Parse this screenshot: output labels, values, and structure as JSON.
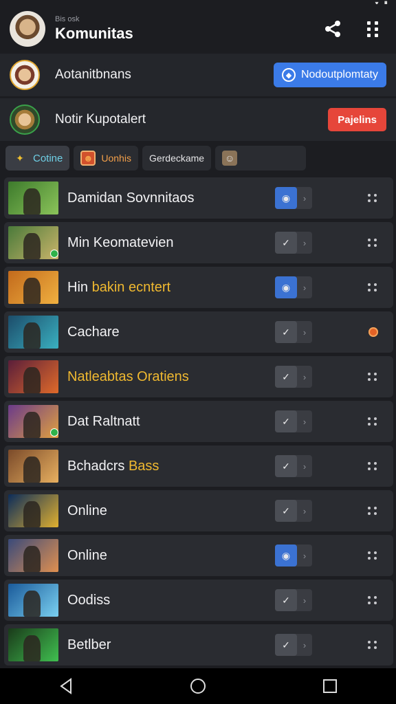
{
  "header": {
    "subtitle": "Bis osk",
    "title": "Komunitas"
  },
  "notifications": [
    {
      "text": "Aotanitbnans",
      "action": "Nodoutplomtaty",
      "action_color": "#3b7be8"
    },
    {
      "text": "Notir Kupotalert",
      "action": "Pajelins",
      "action_color": "#e6463a"
    }
  ],
  "chips": [
    {
      "label": "Cotine",
      "icon": "trophy-icon"
    },
    {
      "label": "Uonhis",
      "icon": "character-icon"
    },
    {
      "label": "Gerdeckame",
      "icon": ""
    },
    {
      "label": "",
      "icon": "portrait-icon"
    }
  ],
  "games": [
    {
      "title": "Damidan Sovnnitaos",
      "toggle": "on",
      "thumb": [
        "#3d7a2c",
        "#8bc45a"
      ],
      "badge": false,
      "marker": "menu"
    },
    {
      "title": "Min Keomatevien",
      "toggle": "off",
      "thumb": [
        "#4a7a3a",
        "#c9b46a"
      ],
      "badge": true,
      "marker": "menu"
    },
    {
      "title": "Hin",
      "title_highlight": "bakin ecntert",
      "toggle": "on",
      "thumb": [
        "#c26a1c",
        "#f0b040"
      ],
      "badge": false,
      "marker": "menu"
    },
    {
      "title": "Cachare",
      "toggle": "off",
      "thumb": [
        "#1c4c6a",
        "#3ab0c0"
      ],
      "badge": false,
      "marker": "alert"
    },
    {
      "title": "Natleabtas Oratiens",
      "toggle": "off",
      "thumb": [
        "#5a1e3a",
        "#e06a2a"
      ],
      "badge": false,
      "marker": "menu",
      "gold": true
    },
    {
      "title": "Dat Raltnatt",
      "toggle": "off",
      "thumb": [
        "#6a3a8a",
        "#e0a040"
      ],
      "badge": true,
      "marker": "menu"
    },
    {
      "title": "Bchadcrs",
      "title_highlight": "Bass",
      "toggle": "off",
      "thumb": [
        "#7a4a2a",
        "#e8b060"
      ],
      "badge": false,
      "marker": "menu"
    },
    {
      "title": "Online",
      "toggle": "off",
      "thumb": [
        "#0c2c5a",
        "#e0b030"
      ],
      "badge": false,
      "marker": "menu"
    },
    {
      "title": "Online",
      "toggle": "on",
      "thumb": [
        "#3a4a7a",
        "#e09050"
      ],
      "badge": false,
      "marker": "menu"
    },
    {
      "title": "Oodiss",
      "toggle": "off",
      "thumb": [
        "#1a5a9a",
        "#7ad0f0"
      ],
      "badge": false,
      "marker": "menu"
    },
    {
      "title": "Betlber",
      "toggle": "off",
      "thumb": [
        "#1a3a1a",
        "#40c050"
      ],
      "badge": false,
      "marker": "menu"
    }
  ],
  "colors": {
    "background": "#1c1d21",
    "row": "#2a2c31",
    "accent_blue": "#3b7be8",
    "accent_red": "#e6463a",
    "highlight": "#f0b930"
  }
}
